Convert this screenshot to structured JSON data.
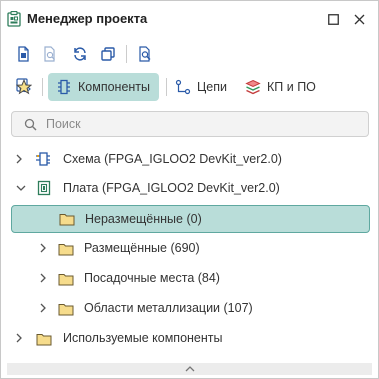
{
  "window": {
    "title": "Менеджер проекта",
    "app_icon": "project-manager-icon",
    "buttons": [
      "maximize-icon",
      "close-icon"
    ]
  },
  "toolbar": {
    "icons": [
      "add-document-icon",
      "filter-document-icon",
      "refresh-icon",
      "copy-windows-icon",
      "search-document-icon"
    ]
  },
  "view_tabs": {
    "items": [
      {
        "icon": "eye-icon",
        "label": ""
      },
      {
        "icon": "star-icon",
        "label": ""
      },
      {
        "icon": "component-icon",
        "label": "Компоненты",
        "active": true
      },
      {
        "icon": "net-icon",
        "label": "Цепи"
      },
      {
        "icon": "layers-icon",
        "label": "КП и ПО"
      }
    ]
  },
  "search": {
    "placeholder": "Поиск",
    "value": ""
  },
  "tree": {
    "rows": [
      {
        "label": "Схема (FPGA_IGLOO2 DevKit_ver2.0)",
        "icon": "schematic-icon",
        "expanded": false,
        "level": 0
      },
      {
        "label": "Плата (FPGA_IGLOO2 DevKit_ver2.0)",
        "icon": "board-icon",
        "expanded": true,
        "level": 0
      },
      {
        "label": "Неразмещённые (0)",
        "icon": "folder-icon",
        "expanded": null,
        "level": 1,
        "selected": true
      },
      {
        "label": "Размещённые (690)",
        "icon": "folder-icon",
        "expanded": false,
        "level": 1
      },
      {
        "label": "Посадочные места (84)",
        "icon": "folder-icon",
        "expanded": false,
        "level": 1
      },
      {
        "label": "Области металлизации (107)",
        "icon": "folder-icon",
        "expanded": false,
        "level": 1
      },
      {
        "label": "Используемые компоненты",
        "icon": "folder-icon",
        "expanded": false,
        "level": 0
      }
    ]
  },
  "colors": {
    "selection_bg": "#b9ddd9",
    "selection_border": "#5fa8a0",
    "accent_icon": "#2a5aa8",
    "folder": "#e9c874"
  }
}
